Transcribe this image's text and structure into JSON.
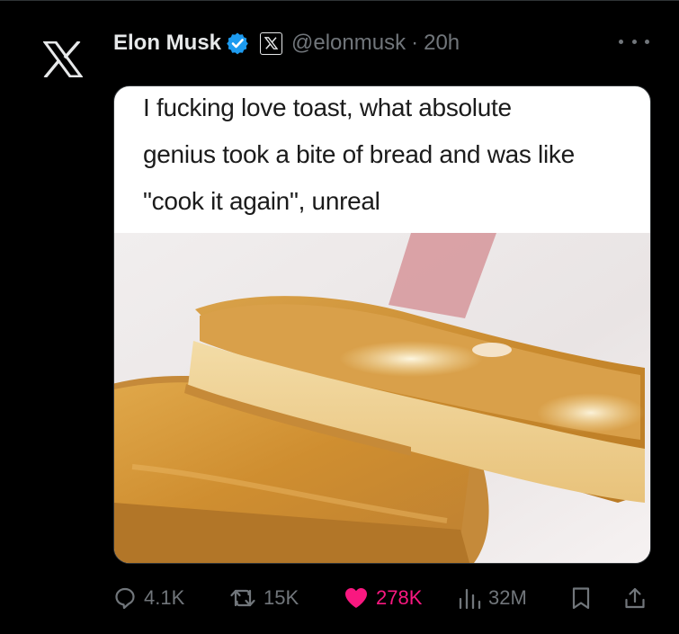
{
  "post": {
    "display_name": "Elon Musk",
    "handle": "@elonmusk",
    "separator": "·",
    "time": "20h",
    "media": {
      "caption_lines": [
        "I fucking love toast, what absolute",
        "genius took a bite of bread and was like",
        "\"cook it again\", unreal"
      ]
    }
  },
  "actions": {
    "replies": "4.1K",
    "reposts": "15K",
    "likes": "278K",
    "views": "32M"
  },
  "colors": {
    "background": "#000000",
    "text": "#e7e9ea",
    "muted": "#71767b",
    "like": "#f91880",
    "verified": "#1d9bf0"
  },
  "icons": [
    "x-logo-icon",
    "verified-badge-icon",
    "x-affiliate-icon",
    "more-icon",
    "reply-icon",
    "repost-icon",
    "like-icon",
    "views-icon",
    "bookmark-icon",
    "share-icon"
  ]
}
